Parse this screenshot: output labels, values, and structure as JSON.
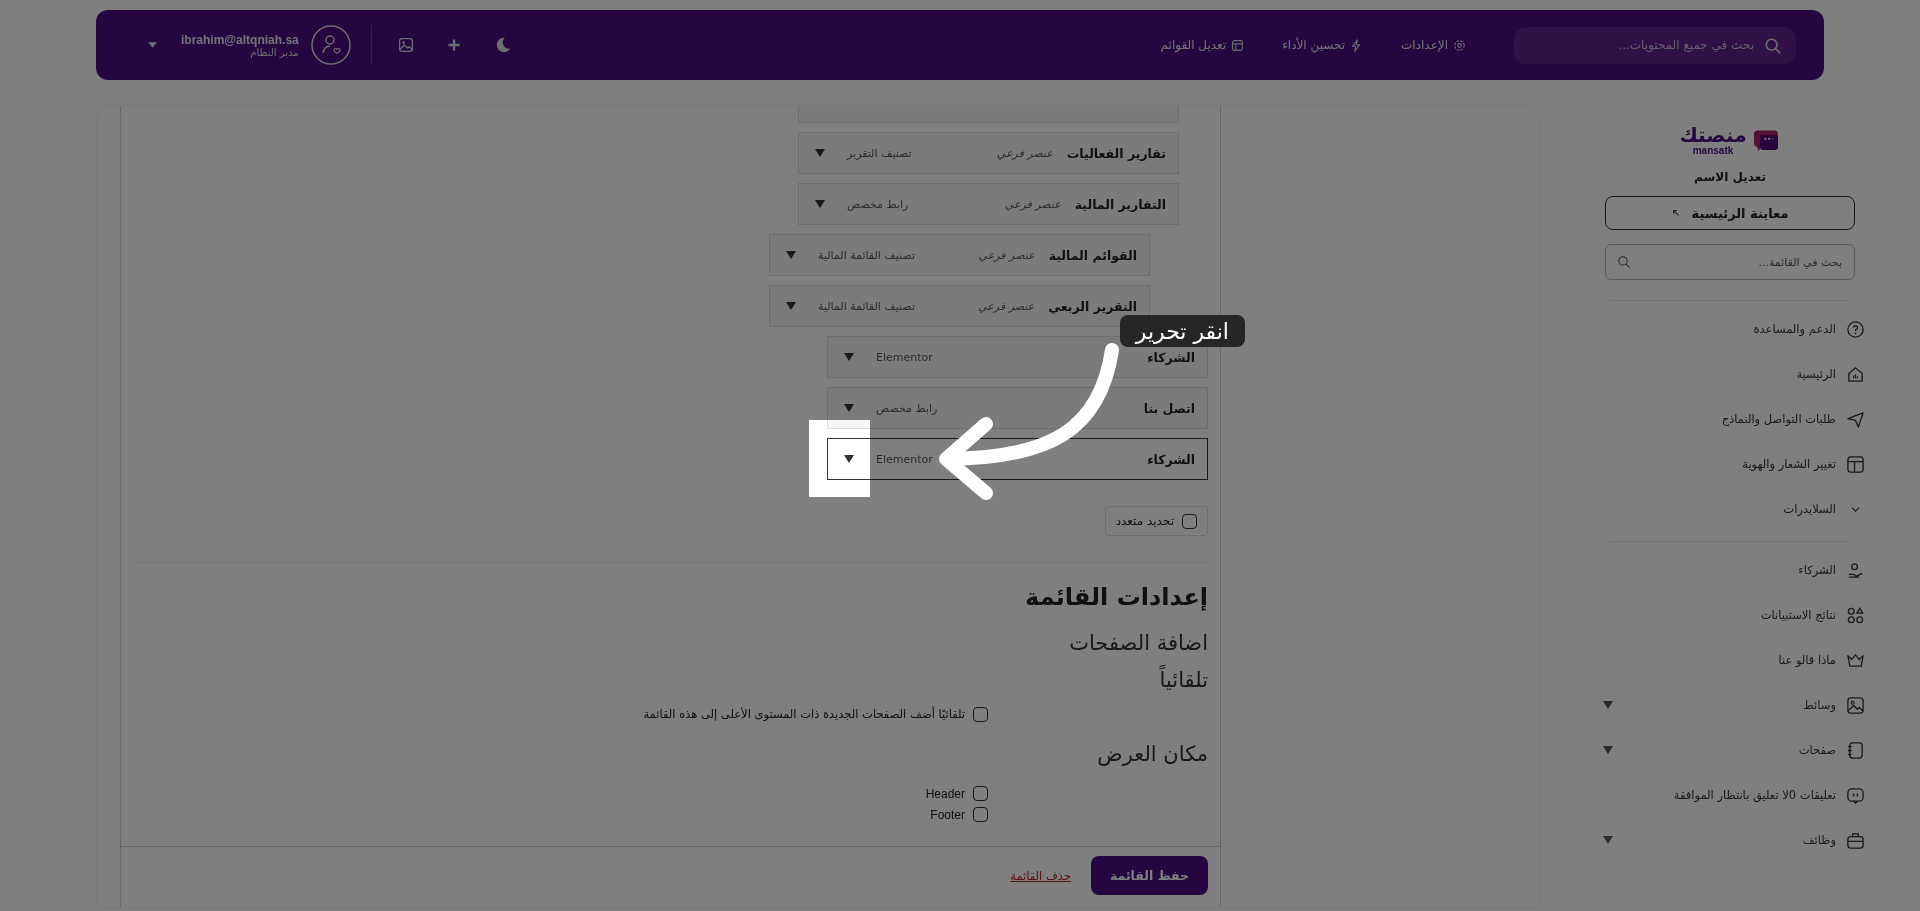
{
  "header": {
    "search": {
      "placeholder": "بحث في جميع المحتويات..."
    },
    "nav": [
      {
        "label": "الإعدادات"
      },
      {
        "label": "تحسين الأداء"
      },
      {
        "label": "تعديل القوائم"
      }
    ],
    "user": {
      "email": "ibrahim@altqniah.sa",
      "role": "مدير النظام"
    }
  },
  "sidebar": {
    "logo": {
      "name": "منصتك",
      "sub": "mansatk"
    },
    "site_name": "تعديل الاسم",
    "preview_button": "معاينة الرئيسية",
    "search": {
      "placeholder": "بحث في القائمة..."
    },
    "groups": [
      [
        {
          "label": "الدعم والمساعدة",
          "kind": "link"
        },
        {
          "label": "الرئيسية",
          "kind": "link"
        },
        {
          "label": "طلبات التواصل والنماذج",
          "kind": "link"
        },
        {
          "label": "تغيير الشعار والهوية",
          "kind": "link"
        },
        {
          "label": "السلايدرات",
          "kind": "group"
        }
      ],
      [
        {
          "label": "الشركاء",
          "kind": "link"
        },
        {
          "label": "نتائج الاستبيانات",
          "kind": "link"
        },
        {
          "label": "ماذا قالو عنا",
          "kind": "link"
        },
        {
          "label": "وسائط",
          "kind": "submenu"
        },
        {
          "label": "صفحات",
          "kind": "submenu"
        },
        {
          "label": "تعليقات 0لا تعليق بانتظار الموافقة",
          "kind": "link"
        },
        {
          "label": "وظائف",
          "kind": "submenu"
        }
      ]
    ]
  },
  "menu_items": [
    {
      "children": [
        {
          "title": "تقارير الفعاليات",
          "sub_label": "عنصر فرعي",
          "type": "تصنيف التقرير",
          "selected": false
        },
        {
          "title": "التقارير المالية",
          "sub_label": "عنصر فرعي",
          "type": "رابط مخصص",
          "selected": false,
          "children": [
            {
              "title": "القوائم المالية",
              "sub_label": "عنصر فرعي",
              "type": "تصنيف القائمة المالية",
              "selected": false
            },
            {
              "title": "التقرير الربعي",
              "sub_label": "عنصر فرعي",
              "type": "تصنيف القائمة المالية",
              "selected": false
            }
          ]
        }
      ]
    },
    {
      "title": "الشركاء",
      "type": "Elementor",
      "selected": false
    },
    {
      "title": "اتصل بنا",
      "type": "رابط مخصص",
      "selected": false
    },
    {
      "title": "الشركاء",
      "type": "Elementor",
      "selected": true
    }
  ],
  "bulk_select": {
    "label": "تحديد متعدد",
    "checked": false
  },
  "settings": {
    "title": "إعدادات القائمة",
    "auto_add": {
      "label": "اضافة الصفحات تلقائياً",
      "option": "تلقائيًا أضف الصفحات الجديدة ذات المستوى الأعلى إلى هذه القائمة",
      "checked": false
    },
    "locations": {
      "label": "مكان العرض",
      "options": [
        {
          "label": "Header",
          "checked": false
        },
        {
          "label": "Footer",
          "checked": false
        }
      ]
    }
  },
  "footer": {
    "save_button": "حفظ القائمة",
    "delete_link": "حذف القائمة"
  },
  "tutorial": {
    "tip": "انقر تحرير"
  }
}
